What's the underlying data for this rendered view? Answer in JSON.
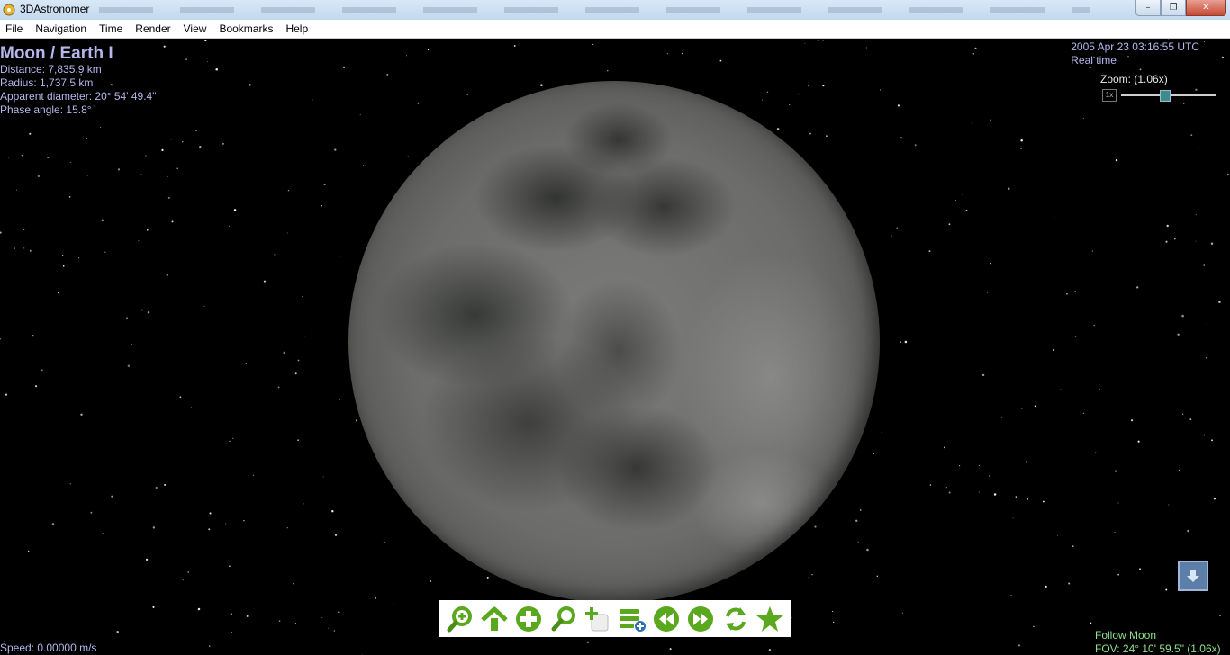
{
  "window": {
    "title": "3DAstronomer",
    "minimize": "–",
    "restore": "❐",
    "close": "✕"
  },
  "menu": [
    "File",
    "Navigation",
    "Time",
    "Render",
    "View",
    "Bookmarks",
    "Help"
  ],
  "object": {
    "name": "Moon / Earth I",
    "distance": "Distance: 7,835.9 km",
    "radius": "Radius: 1,737.5 km",
    "apparent_diameter": "Apparent diameter: 20° 54' 49.4\"",
    "phase_angle": "Phase angle: 15.8°"
  },
  "time": {
    "datetime": "2005 Apr 23 03:16:55 UTC",
    "mode": "Real time"
  },
  "zoom": {
    "label": "Zoom: (1.06x)",
    "reset_label": "1x",
    "level_fraction": 0.45
  },
  "toolbar": {
    "buttons": [
      {
        "name": "zoom-in-magnifier-icon",
        "tip": "Zoom in"
      },
      {
        "name": "up-arrow-icon",
        "tip": "Go up"
      },
      {
        "name": "plus-circle-icon",
        "tip": "Add"
      },
      {
        "name": "search-icon",
        "tip": "Search"
      },
      {
        "name": "add-document-icon",
        "tip": "New"
      },
      {
        "name": "list-add-icon",
        "tip": "List"
      },
      {
        "name": "rewind-icon",
        "tip": "Rewind"
      },
      {
        "name": "fast-forward-icon",
        "tip": "Forward"
      },
      {
        "name": "sync-icon",
        "tip": "Sync"
      },
      {
        "name": "star-icon",
        "tip": "Favorite"
      }
    ],
    "accent": "#5aa81e"
  },
  "status": {
    "speed": "Speed: 0.00000 m/s",
    "follow": "Follow Moon",
    "fov": "FOV: 24° 10' 59.5\" (1.06x)"
  },
  "colors": {
    "info_text": "#b6b6ec",
    "follow_text": "#8fe08f"
  }
}
